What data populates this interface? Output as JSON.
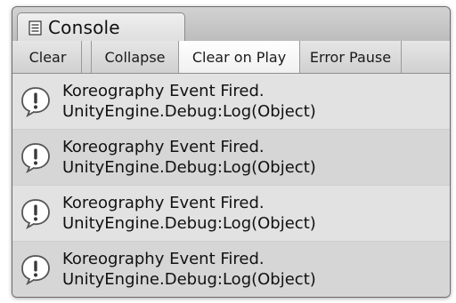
{
  "window": {
    "tab_label": "Console",
    "tab_icon": "console-icon"
  },
  "toolbar": {
    "buttons": [
      {
        "label": "Clear",
        "active": false
      },
      {
        "label": "Collapse",
        "active": false
      },
      {
        "label": "Clear on Play",
        "active": true
      },
      {
        "label": "Error Pause",
        "active": false
      }
    ]
  },
  "log": {
    "entry_icon": "info-icon",
    "entries": [
      {
        "message": "Koreography Event Fired.",
        "trace": "UnityEngine.Debug:Log(Object)"
      },
      {
        "message": "Koreography Event Fired.",
        "trace": "UnityEngine.Debug:Log(Object)"
      },
      {
        "message": "Koreography Event Fired.",
        "trace": "UnityEngine.Debug:Log(Object)"
      },
      {
        "message": "Koreography Event Fired.",
        "trace": "UnityEngine.Debug:Log(Object)"
      }
    ]
  }
}
